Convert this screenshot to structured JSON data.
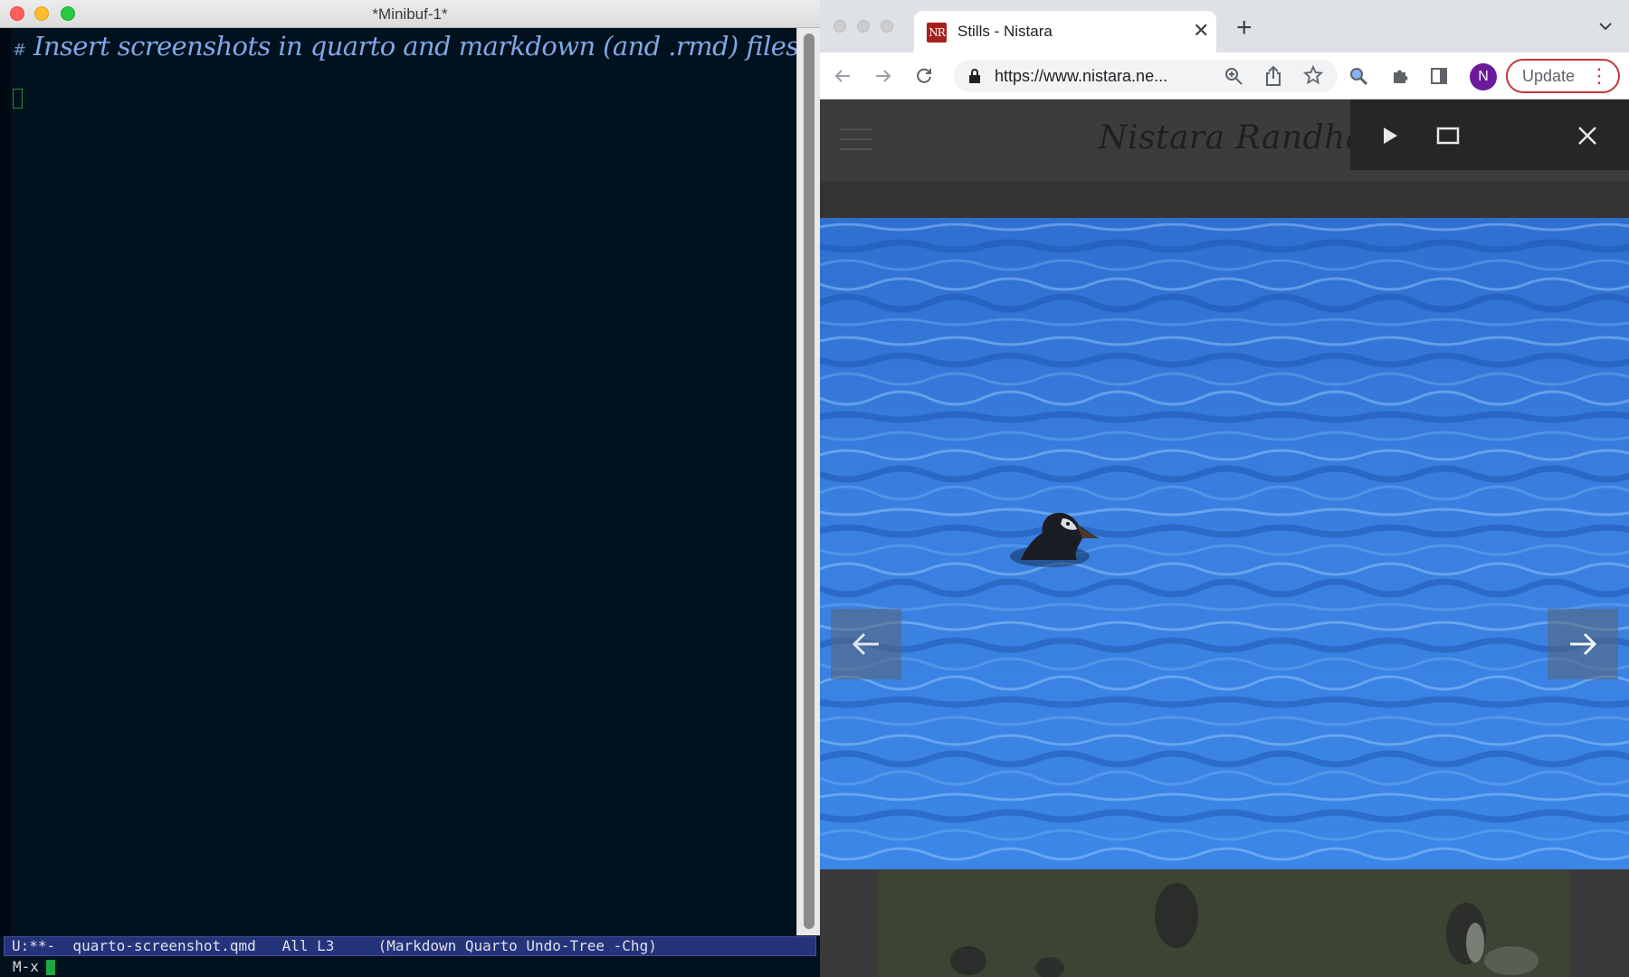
{
  "emacs": {
    "window_title": "*Minibuf-1*",
    "heading_marker": "#",
    "heading_text": "Insert screenshots in quarto and markdown (and .rmd) files within emacs",
    "modeline": "U:**-  quarto-screenshot.qmd   All L3     (Markdown Quarto Undo-Tree -Chg)",
    "minibuffer_prompt": "M-x"
  },
  "browser": {
    "tab_title": "Stills - Nistara",
    "favicon_text": "NR",
    "url": "https://www.nistara.ne...",
    "profile_initial": "N",
    "update_label": "Update",
    "site_title": "Nistara Randhawa",
    "icons": [
      "back-icon",
      "forward-icon",
      "reload-icon",
      "lock-icon",
      "zoom-icon",
      "share-icon",
      "star-icon",
      "extension-icon",
      "puzzle-icon",
      "sidepanel-icon",
      "menu-icon",
      "play-icon",
      "fullscreen-icon",
      "close-icon",
      "prev-arrow-icon",
      "next-arrow-icon"
    ]
  },
  "colors": {
    "emacs_bg": "#02111e",
    "heading": "#7fa8e6",
    "modeline_bg": "#24337a",
    "update_border": "#c5363b",
    "avatar": "#6a1b9a"
  }
}
